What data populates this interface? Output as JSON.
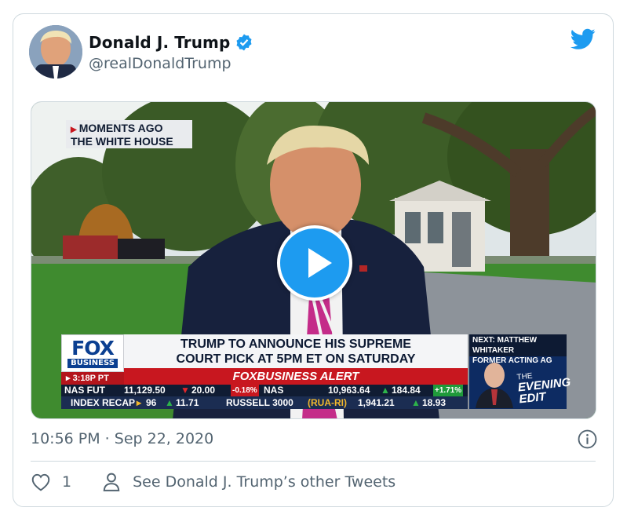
{
  "tweet": {
    "author_name": "Donald J. Trump",
    "author_handle": "@realDonaldTrump",
    "timestamp": "10:56 PM · Sep 22, 2020",
    "like_count": "1",
    "other_tweets_label": "See Donald J. Trump’s other Tweets"
  },
  "video": {
    "location_tag_line1": "MOMENTS AGO",
    "location_tag_line2": "THE WHITE HOUSE",
    "network_logo": "FOX",
    "network_sub": "BUSINESS",
    "headline_line1": "TRUMP TO ANNOUNCE HIS SUPREME",
    "headline_line2": "COURT PICK AT 5PM ET ON SATURDAY",
    "time_label": "3:18P PT",
    "alert_label": "FOXBUSINESS ALERT",
    "ticker_row1": {
      "nas_fut_label": "NAS FUT",
      "nas_fut_value": "11,129.50",
      "nas_fut_change": "20.00",
      "nas_fut_pct": "-0.18%",
      "nas_label": "NAS",
      "nas_value": "10,963.64",
      "nas_change": "184.84",
      "nas_pct": "+1.71%"
    },
    "ticker_row2": {
      "index_label": "INDEX RECAP",
      "prev_value": "96",
      "prev_change": "11.71",
      "russell_label": "RUSSELL 3000",
      "russell_code": "(RUA-RI)",
      "russell_value": "1,941.21",
      "russell_change": "18.93"
    },
    "next_line1": "NEXT: MATTHEW WHITAKER",
    "next_line2": "FORMER ACTING AG",
    "show_line1": "THE",
    "show_line2": "EVENING",
    "show_line3": "EDIT"
  },
  "icons": {
    "verified": "verified-badge-icon",
    "platform": "twitter-bird-icon",
    "play": "play-icon",
    "info": "info-icon",
    "like": "heart-icon",
    "profile": "person-icon"
  },
  "colors": {
    "accent": "#1d9bf0",
    "secondary_text": "#536471",
    "border": "#cfd9de"
  }
}
